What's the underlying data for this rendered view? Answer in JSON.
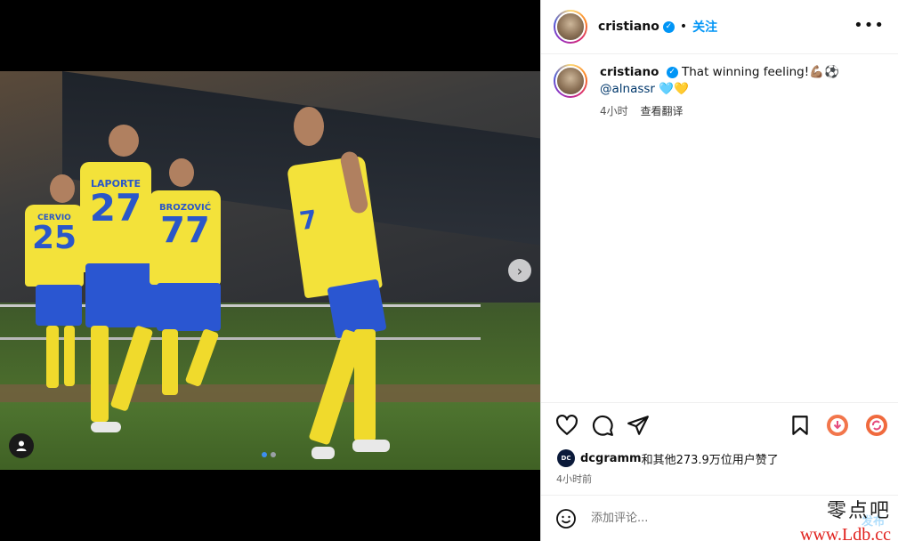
{
  "post": {
    "username": "cristiano",
    "separator": "•",
    "follow_label": "关注",
    "more_icon": "more-horizontal-icon",
    "caption_text": "That winning feeling!",
    "caption_emojis": "💪🏽⚽",
    "mention": "@alnassr",
    "mention_emojis": "🩵💛",
    "time_short": "4小时",
    "translate_label": "查看翻译",
    "liked_by_user": "dcgramm",
    "liked_by_avatar_text": "DC",
    "likes_text": "和其他273.9万位用户赞了",
    "time_ago": "4小时前",
    "comment_placeholder": "添加评论...",
    "post_label": "发布"
  },
  "media": {
    "jersey_numbers": [
      "25",
      "27",
      "77",
      "7"
    ],
    "jersey_names": [
      "CERVIO",
      "LAPORTE",
      "BROZOVIĆ"
    ],
    "carousel_index": 1,
    "carousel_total": 2
  },
  "watermark": {
    "zh": "零点吧",
    "url": "www.Ldb.cc"
  },
  "colors": {
    "accent": "#0095f6",
    "jersey_yellow": "#f3e23a",
    "shorts_blue": "#2a56d1"
  }
}
